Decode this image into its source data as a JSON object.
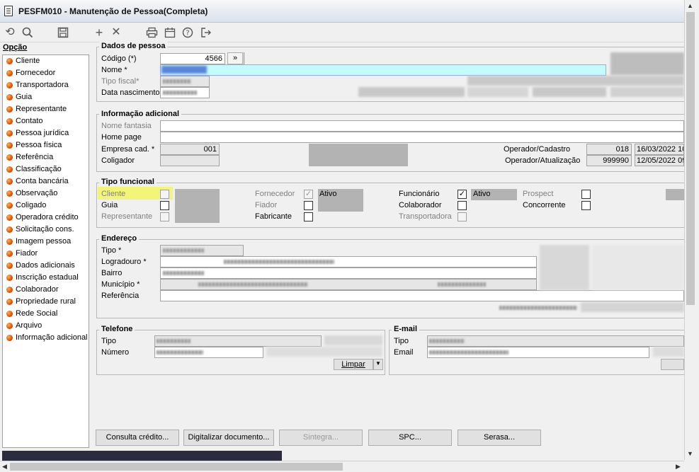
{
  "window": {
    "title": "PESFM010 - Manutenção de Pessoa(Completa)"
  },
  "toolbar": {
    "icons": [
      "undo-icon",
      "search-icon",
      "save-icon",
      "add-icon",
      "close-icon",
      "print-icon",
      "calendar-icon",
      "help-icon",
      "exit-icon"
    ]
  },
  "sidebar": {
    "label": "Opção",
    "items": [
      "Cliente",
      "Fornecedor",
      "Transportadora",
      "Guia",
      "Representante",
      "Contato",
      "Pessoa jurídica",
      "Pessoa física",
      "Referência",
      "Classificação",
      "Conta bancária",
      "Observação",
      "Coligado",
      "Operadora crédito",
      "Solicitação cons.",
      "Imagem pessoa",
      "Fiador",
      "Dados adicionais",
      "Inscrição estadual",
      "Colaborador",
      "Propriedade rural",
      "Rede Social",
      "Arquivo",
      "Informação adicional"
    ]
  },
  "dados_pessoa": {
    "title": "Dados de pessoa",
    "codigo_label": "Código (*)",
    "codigo_value": "4566",
    "codigo_btn": "»",
    "nome_label": "Nome *",
    "tipo_fiscal_label": "Tipo fiscal*",
    "data_nasc_label": "Data nascimento"
  },
  "info_adicional": {
    "title": "Informação adicional",
    "nome_fantasia_label": "Nome fantasia",
    "home_page_label": "Home page",
    "empresa_cad_label": "Empresa cad. *",
    "empresa_cad_value": "001",
    "coligador_label": "Coligador",
    "operador_cadastro_label": "Operador/Cadastro",
    "operador_cadastro_code": "018",
    "operador_cadastro_date": "16/03/2022 10",
    "operador_atualizacao_label": "Operador/Atualização",
    "operador_atualizacao_code": "999990",
    "operador_atualizacao_date": "12/05/2022 09"
  },
  "tipo_funcional": {
    "title": "Tipo funcional",
    "cliente": "Cliente",
    "guia": "Guia",
    "representante": "Representante",
    "fornecedor": "Fornecedor",
    "fornecedor_status": "Ativo",
    "fiador": "Fiador",
    "fabricante": "Fabricante",
    "funcionario": "Funcionário",
    "funcionario_status": "Ativo",
    "colaborador": "Colaborador",
    "transportadora": "Transportadora",
    "prospect": "Prospect",
    "concorrente": "Concorrente"
  },
  "endereco": {
    "title": "Endereço",
    "tipo_label": "Tipo *",
    "logradouro_label": "Logradouro *",
    "bairro_label": "Bairro",
    "municipio_label": "Município *",
    "referencia_label": "Referência"
  },
  "telefone": {
    "title": "Telefone",
    "tipo_label": "Tipo",
    "numero_label": "Número",
    "limpar_label": "Limpar"
  },
  "email": {
    "title": "E-mail",
    "tipo_label": "Tipo",
    "email_label": "Email"
  },
  "buttons": {
    "consulta_credito": "Consulta crédito...",
    "digitalizar": "Digitalizar documento...",
    "sintegra": "Sintegra...",
    "spc": "SPC...",
    "serasa": "Serasa..."
  }
}
